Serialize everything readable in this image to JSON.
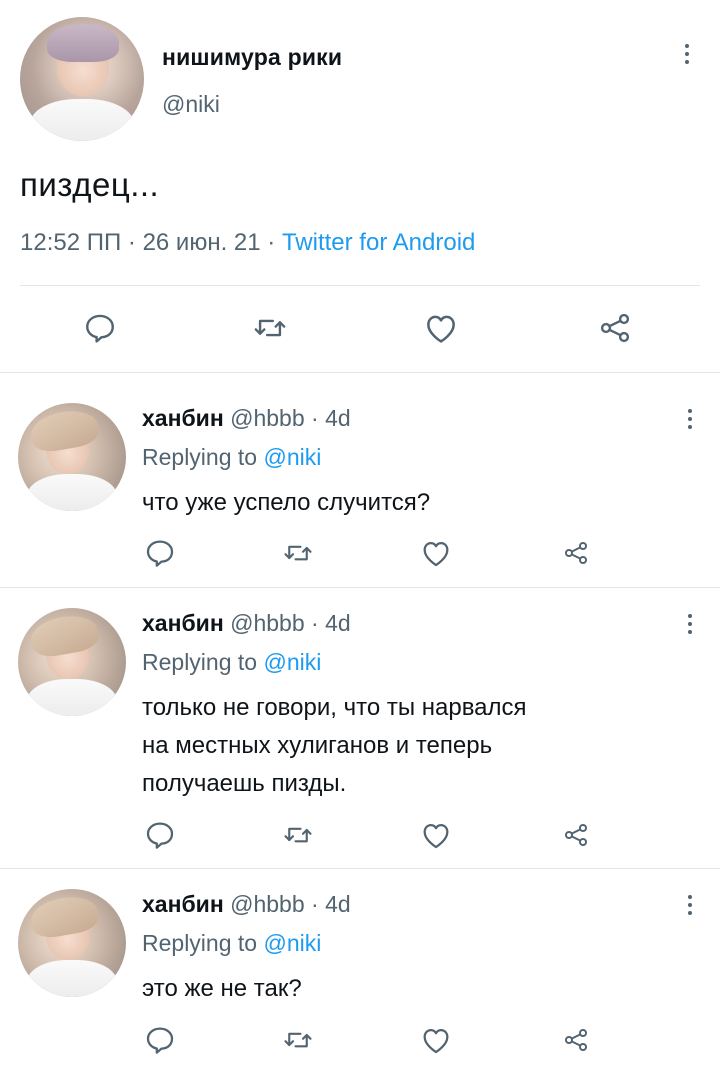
{
  "main_tweet": {
    "display_name": "нишимура рики",
    "handle": "@niki",
    "text": "пиздец...",
    "time": "12:52 ПП",
    "date": "26 июн. 21",
    "separator": " · ",
    "source": "Twitter for Android"
  },
  "action_icons": [
    "reply-icon",
    "retweet-icon",
    "like-icon",
    "share-icon"
  ],
  "more_icon": "more-vertical-icon",
  "replies": [
    {
      "display_name": "ханбин",
      "handle": "@hbbb",
      "age": "4d",
      "replying_prefix": "Replying to ",
      "replying_to": "@niki",
      "text_lines": [
        "что уже успело случится?"
      ]
    },
    {
      "display_name": "ханбин",
      "handle": "@hbbb",
      "age": "4d",
      "replying_prefix": "Replying to ",
      "replying_to": "@niki",
      "text_lines": [
        "только не говори, что ты нарвался",
        "на местных хулиганов и теперь",
        "получаешь пизды."
      ]
    },
    {
      "display_name": "ханбин",
      "handle": "@hbbb",
      "age": "4d",
      "replying_prefix": "Replying to ",
      "replying_to": "@niki",
      "text_lines": [
        "это же не так?"
      ]
    }
  ],
  "colors": {
    "text": "#0f1419",
    "secondary": "#536471",
    "link": "#1d9bf0",
    "divider": "#e3e6e8"
  }
}
